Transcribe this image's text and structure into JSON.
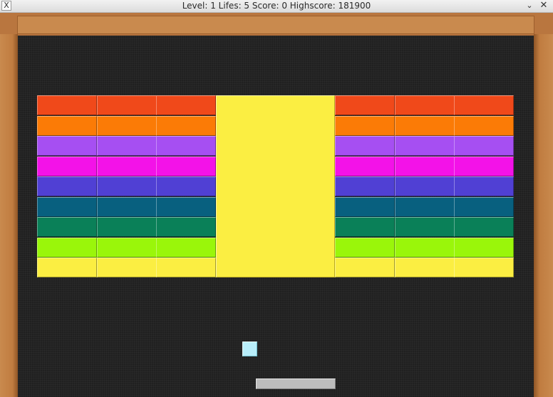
{
  "window": {
    "title": "Level: 1 Lifes: 5 Score: 0 Highscore: 181900",
    "icon": "x-app-icon",
    "controls": {
      "collapse_symbol": "⌄",
      "close_symbol": "✕"
    }
  },
  "game": {
    "level": 1,
    "lifes": 5,
    "score": 0,
    "highscore": 181900
  },
  "bricks": {
    "columns": 6,
    "rows": [
      {
        "color": "#f0491a"
      },
      {
        "color": "#fb7b06"
      },
      {
        "color": "#a64ff2"
      },
      {
        "color": "#f312e8"
      },
      {
        "color": "#5040d4"
      },
      {
        "color": "#08607f"
      },
      {
        "color": "#0a8058"
      },
      {
        "color": "#9af60a"
      },
      {
        "color": "#fbee42"
      }
    ]
  },
  "big_brick": {
    "color": "#fbee42"
  },
  "ball": {
    "color": "#b8eefa"
  },
  "paddle": {
    "color": "#bdbdbd"
  }
}
